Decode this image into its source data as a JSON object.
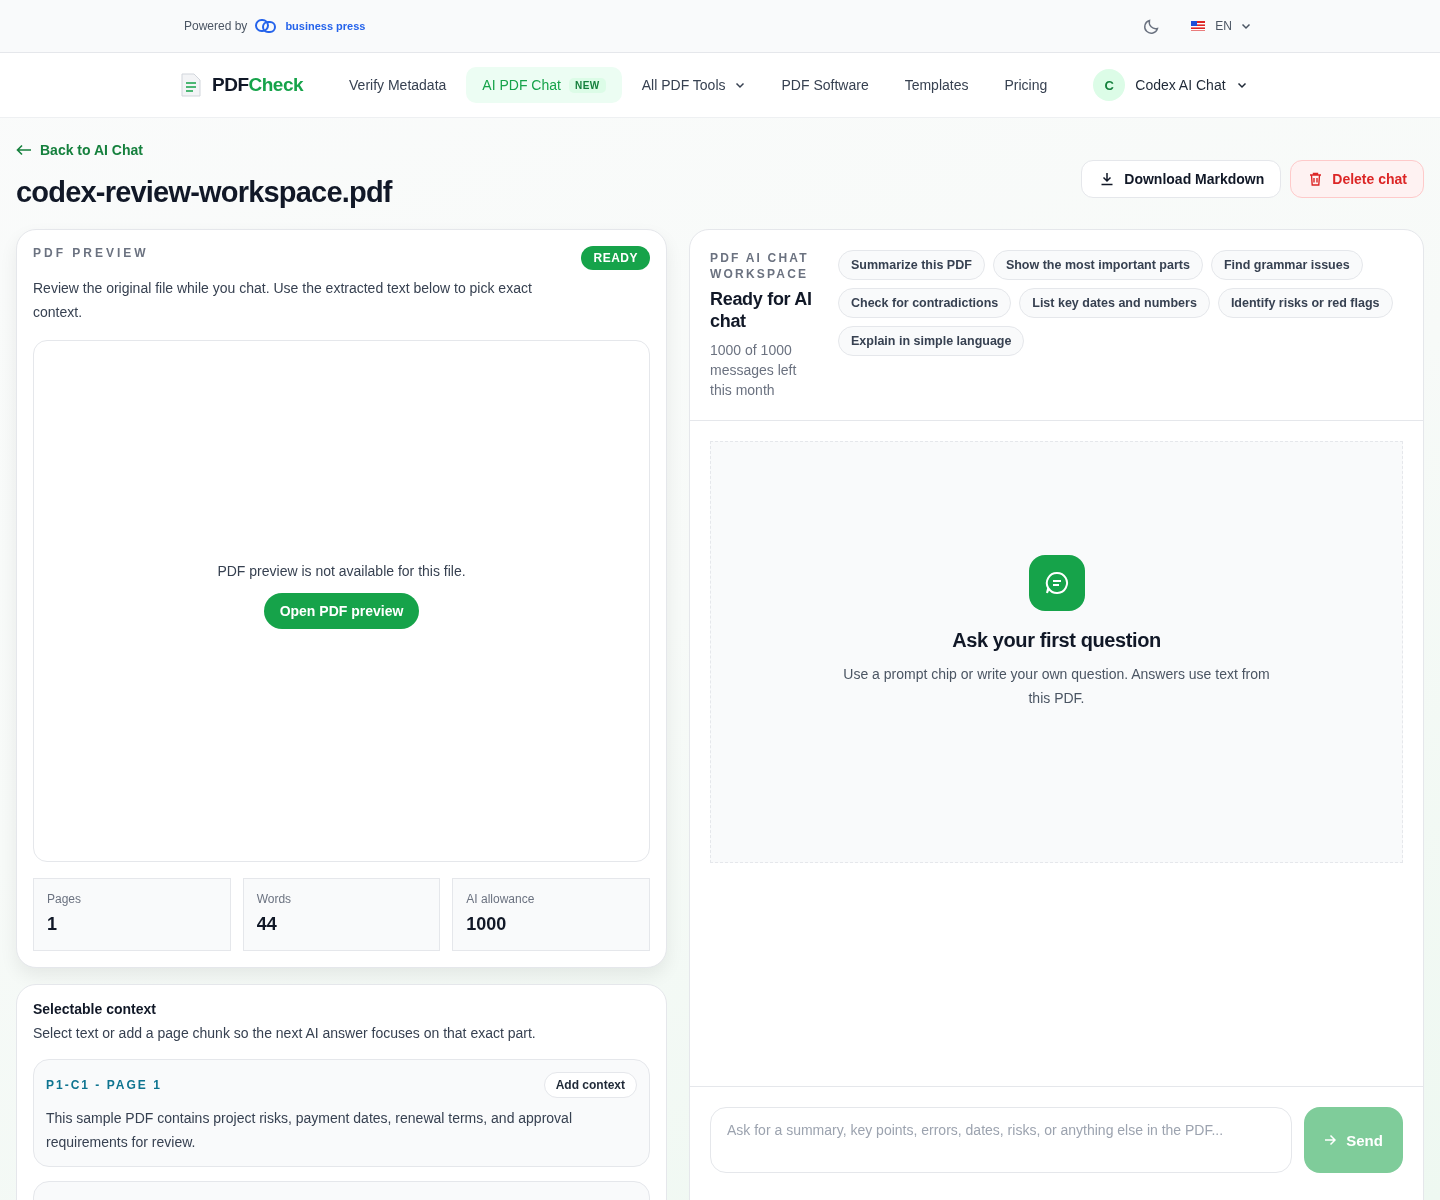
{
  "topbar": {
    "powered_by": "Powered by",
    "brand": "business press",
    "language": "EN"
  },
  "nav": {
    "logo_prefix": "PDF",
    "logo_suffix": "Check",
    "items": [
      {
        "label": "Verify Metadata",
        "selected": false
      },
      {
        "label": "AI PDF Chat",
        "selected": true,
        "badge": "NEW"
      },
      {
        "label": "All PDF Tools",
        "selected": false,
        "dropdown": true
      },
      {
        "label": "PDF Software",
        "selected": false
      },
      {
        "label": "Templates",
        "selected": false
      },
      {
        "label": "Pricing",
        "selected": false
      }
    ],
    "account": {
      "initial": "C",
      "name": "Codex AI Chat"
    }
  },
  "back_link": "Back to AI Chat",
  "title": "codex-review-workspace.pdf",
  "actions": {
    "download": "Download Markdown",
    "delete": "Delete chat"
  },
  "preview": {
    "eyebrow": "PDF PREVIEW",
    "status": "READY",
    "description": "Review the original file while you chat. Use the extracted text below to pick exact context.",
    "unavailable": "PDF preview is not available for this file.",
    "open_button": "Open PDF preview",
    "stats": [
      {
        "label": "Pages",
        "value": "1"
      },
      {
        "label": "Words",
        "value": "44"
      },
      {
        "label": "AI allowance",
        "value": "1000"
      }
    ]
  },
  "context": {
    "title": "Selectable context",
    "description": "Select text or add a page chunk so the next AI answer focuses on that exact part.",
    "chunks": [
      {
        "label": "P1-C1 - PAGE 1",
        "button": "Add context",
        "text": "This sample PDF contains project risks, payment dates, renewal terms, and approval requirements for review."
      }
    ]
  },
  "chat": {
    "eyebrow": "PDF AI CHAT WORKSPACE",
    "heading": "Ready for AI chat",
    "quota": "1000 of 1000 messages left this month",
    "prompts": [
      "Summarize this PDF",
      "Show the most important parts",
      "Find grammar issues",
      "Check for contradictions",
      "List key dates and numbers",
      "Identify risks or red flags",
      "Explain in simple language"
    ],
    "empty_title": "Ask your first question",
    "empty_text": "Use a prompt chip or write your own question. Answers use text from this PDF.",
    "input_placeholder": "Ask for a summary, key points, errors, dates, risks, or anything else in the PDF...",
    "send": "Send",
    "send_disabled": true
  }
}
